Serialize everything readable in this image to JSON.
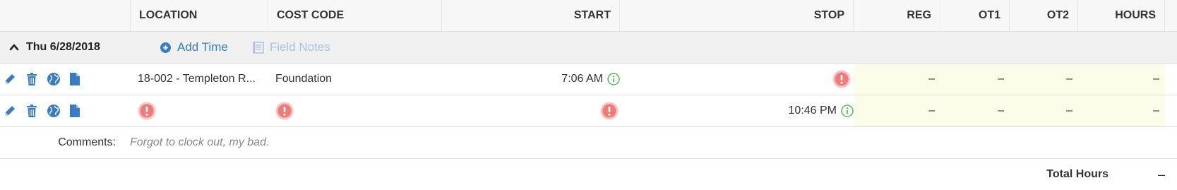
{
  "colors": {
    "accent": "#3a7cc1",
    "error": "#f08080",
    "info": "#5cb85c",
    "highlight": "#fcfde8",
    "header_bg": "#f7f7f7",
    "day_bg": "#f0f0f0"
  },
  "header": {
    "location": "LOCATION",
    "cost_code": "COST CODE",
    "start": "START",
    "stop": "STOP",
    "reg": "REG",
    "ot1": "OT1",
    "ot2": "OT2",
    "hours": "HOURS"
  },
  "day": {
    "label": "Thu 6/28/2018",
    "add_time": "Add Time",
    "field_notes": "Field Notes",
    "icons": {
      "toggle": "chevron-up-icon",
      "add": "plus-circle-icon",
      "notes": "notes-icon"
    }
  },
  "entries": [
    {
      "location": "18-002 - Templeton R...",
      "cost_code": "Foundation",
      "start": "7:06 AM",
      "stop": "",
      "reg": "–",
      "ot1": "–",
      "ot2": "–",
      "hours": "–"
    },
    {
      "location": "",
      "cost_code": "",
      "start": "",
      "stop": "10:46 PM",
      "reg": "–",
      "ot1": "–",
      "ot2": "–",
      "hours": "–"
    }
  ],
  "row_icons": [
    "edit-icon",
    "delete-icon",
    "globe-icon",
    "document-icon"
  ],
  "comments": {
    "label": "Comments:",
    "text": "Forgot to clock out, my bad."
  },
  "total": {
    "label": "Total Hours",
    "value": "–"
  }
}
